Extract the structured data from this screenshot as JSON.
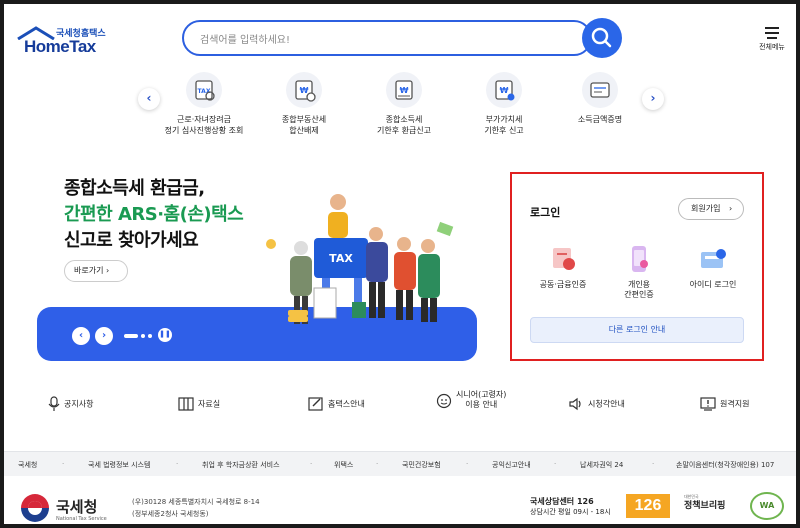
{
  "header": {
    "logo_small": "국세청홈택스",
    "logo_big": "HomeTax",
    "search_placeholder": "검색어를 입력하세요!",
    "menu_label": "전체메뉴"
  },
  "quick_menu": [
    {
      "label": "근로·자녀장려금\n정기 심사진행상황 조회",
      "icon": "tax-document-icon"
    },
    {
      "label": "종합부동산세\n합산배제",
      "icon": "property-tax-icon"
    },
    {
      "label": "종합소득세\n기한후 환급신고",
      "icon": "income-tax-refund-icon"
    },
    {
      "label": "부가가치세\n기한후 신고",
      "icon": "vat-return-icon"
    },
    {
      "label": "소득금액증명",
      "icon": "income-certificate-icon"
    }
  ],
  "hero": {
    "line1": "종합소득세 환급금,",
    "line2": "간편한 ARS·홈(손)택스",
    "line3": "신고로 찾아가세요",
    "cta": "바로가기",
    "illus_sign": "TAX"
  },
  "login": {
    "title": "로그인",
    "join": "회원가입",
    "options": [
      {
        "label": "공동·금융인증",
        "icon": "certificate-icon"
      },
      {
        "label": "개인용\n간편인증",
        "icon": "mobile-auth-icon"
      },
      {
        "label": "아이디 로그인",
        "icon": "id-login-icon"
      }
    ],
    "other": "다른 로그인 안내"
  },
  "links": [
    {
      "label": "공지사항",
      "icon": "microphone-icon"
    },
    {
      "label": "자료실",
      "icon": "archive-icon"
    },
    {
      "label": "홈택스안내",
      "icon": "guide-icon"
    },
    {
      "label": "시니어(고령자)\n이용 안내",
      "icon": "senior-icon"
    },
    {
      "label": "시청각안내",
      "icon": "speaker-icon"
    },
    {
      "label": "원격지원",
      "icon": "remote-support-icon"
    }
  ],
  "footer_links": [
    "국세청",
    "국세 법령정보 시스템",
    "취업 후 학자금상환 서비스",
    "위택스",
    "국민건강보험",
    "공익신고안내",
    "납세자권익 24",
    "손말이음센터(청각장애인용) 107"
  ],
  "footer": {
    "org_name": "국세청",
    "org_sub": "National Tax Service",
    "address1": "(우)30128 세종특별자치시 국세청로 8-14",
    "address2": "(정부세종2청사 국세청동)",
    "center_name": "국세상담센터 126",
    "center_hours": "상담시간 평일 09시 - 18시",
    "num_126": "126",
    "policy_small": "대한민국",
    "policy": "정책브리핑",
    "wa": "WA"
  },
  "colors": {
    "primary": "#2a66e8",
    "green": "#1a9a52",
    "login_border": "#e02020"
  }
}
